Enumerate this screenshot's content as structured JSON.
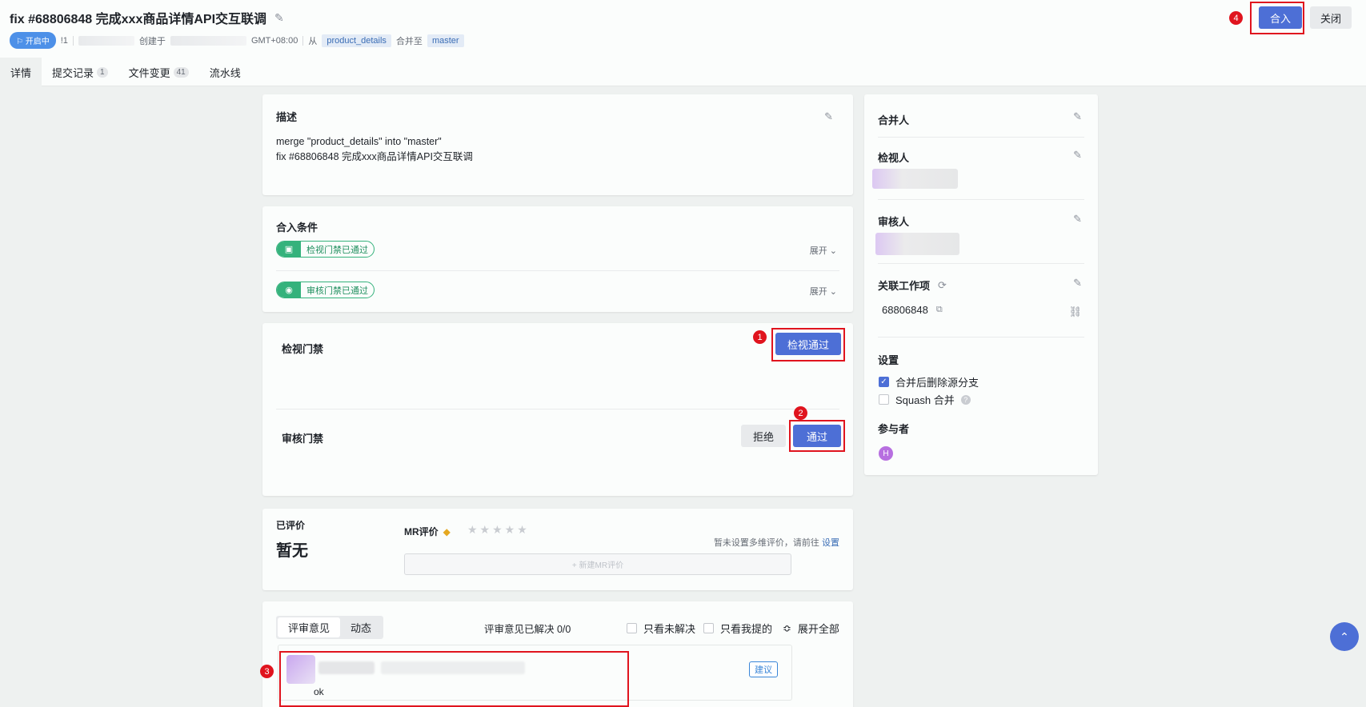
{
  "header": {
    "title": "fix #68806848 完成xxx商品详情API交互联调",
    "status": "开启中",
    "mr_id": "!1",
    "created_at_prefix": "创建于",
    "timezone": "GMT+08:00",
    "from_label": "从",
    "source_branch": "product_details",
    "merge_to_label": "合并至",
    "target_branch": "master",
    "merge_button": "合入",
    "close_button": "关闭"
  },
  "tabs": [
    {
      "label": "详情",
      "count": ""
    },
    {
      "label": "提交记录",
      "count": "1"
    },
    {
      "label": "文件变更",
      "count": "41"
    },
    {
      "label": "流水线",
      "count": ""
    }
  ],
  "description": {
    "title": "描述",
    "line1": "merge \"product_details\" into \"master\"",
    "line2": "fix #68806848 完成xxx商品详情API交互联调"
  },
  "conditions": {
    "title": "合入条件",
    "items": [
      {
        "label": "检视门禁已通过",
        "expand": "展开"
      },
      {
        "label": "审核门禁已通过",
        "expand": "展开"
      }
    ]
  },
  "gates": {
    "review_label": "检视门禁",
    "review_pass_button": "检视通过",
    "audit_label": "审核门禁",
    "reject_button": "拒绝",
    "pass_button": "通过"
  },
  "markers": [
    "1",
    "2",
    "3",
    "4"
  ],
  "rating": {
    "title": "已评价",
    "value": "暂无",
    "mr_label": "MR评价",
    "hint": "暂未设置多维评价，请前往",
    "hint_link": "设置",
    "new_button": "+ 新建MR评价"
  },
  "review": {
    "tab_comments": "评审意见",
    "tab_activity": "动态",
    "resolved": "评审意见已解决 0/0",
    "only_unresolved": "只看未解决",
    "only_mine": "只看我提的",
    "expand_all": "展开全部",
    "comment_text": "ok",
    "suggest_tag": "建议"
  },
  "sidebar": {
    "merger": "合并人",
    "reviewer": "检视人",
    "auditor": "审核人",
    "work_items": "关联工作项",
    "work_item_id": "68806848",
    "settings": "设置",
    "delete_source": "合并后删除源分支",
    "delete_source_checked": true,
    "squash": "Squash 合并",
    "squash_checked": false,
    "participants": "参与者",
    "participant_initial": "H"
  }
}
